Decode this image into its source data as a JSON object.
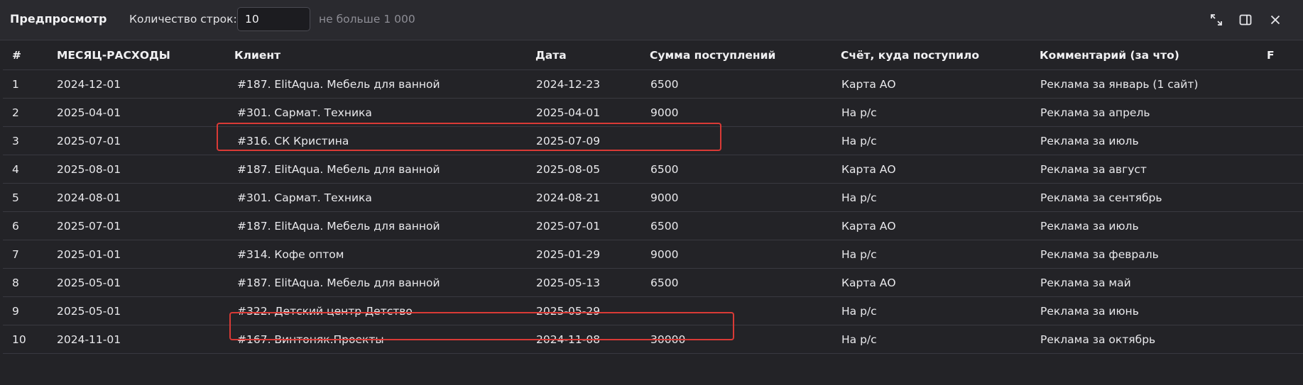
{
  "toolbar": {
    "title": "Предпросмотр",
    "rows_label": "Количество строк:",
    "rows_value": "10",
    "rows_hint": "не больше 1 000",
    "icons": [
      "expand-icon",
      "split-panel-icon",
      "close-icon"
    ]
  },
  "table": {
    "headers": [
      "#",
      "МЕСЯЦ-РАСХОДЫ",
      "Клиент",
      "Дата",
      "Сумма поступлений",
      "Счёт, куда поступило",
      "Комментарий (за что)",
      "F"
    ],
    "rows": [
      [
        "1",
        "2024-12-01",
        "#187. ElitAqua. Мебель для ванной",
        "2024-12-23",
        "6500",
        "Карта АО",
        "Реклама за январь (1 сайт)",
        ""
      ],
      [
        "2",
        "2025-04-01",
        "#301. Сармат. Техника",
        "2025-04-01",
        "9000",
        "На р/с",
        "Реклама за апрель",
        ""
      ],
      [
        "3",
        "2025-07-01",
        "#316. СК Кристина",
        "2025-07-09",
        "",
        "На р/с",
        "Реклама за июль",
        ""
      ],
      [
        "4",
        "2025-08-01",
        "#187. ElitAqua. Мебель для ванной",
        "2025-08-05",
        "6500",
        "Карта АО",
        "Реклама за август",
        ""
      ],
      [
        "5",
        "2024-08-01",
        "#301. Сармат. Техника",
        "2024-08-21",
        "9000",
        "На р/с",
        "Реклама за сентябрь",
        ""
      ],
      [
        "6",
        "2025-07-01",
        "#187. ElitAqua. Мебель для ванной",
        "2025-07-01",
        "6500",
        "Карта АО",
        "Реклама за июль",
        ""
      ],
      [
        "7",
        "2025-01-01",
        "#314. Кофе оптом",
        "2025-01-29",
        "9000",
        "На р/с",
        "Реклама за февраль",
        ""
      ],
      [
        "8",
        "2025-05-01",
        "#187. ElitAqua. Мебель для ванной",
        "2025-05-13",
        "6500",
        "Карта АО",
        "Реклама за май",
        ""
      ],
      [
        "9",
        "2025-05-01",
        "#322. Детский центр Детство",
        "2025-05-29",
        "",
        "На р/с",
        "Реклама за июнь",
        ""
      ],
      [
        "10",
        "2024-11-01",
        "#167. Винтоняк.Проекты",
        "2024-11-08",
        "30000",
        "На р/с",
        "Реклама за октябрь",
        ""
      ]
    ]
  },
  "colors": {
    "background": "#232327",
    "toolbar": "#2a2a2f",
    "divider": "#393940",
    "highlight": "#d93a36"
  }
}
